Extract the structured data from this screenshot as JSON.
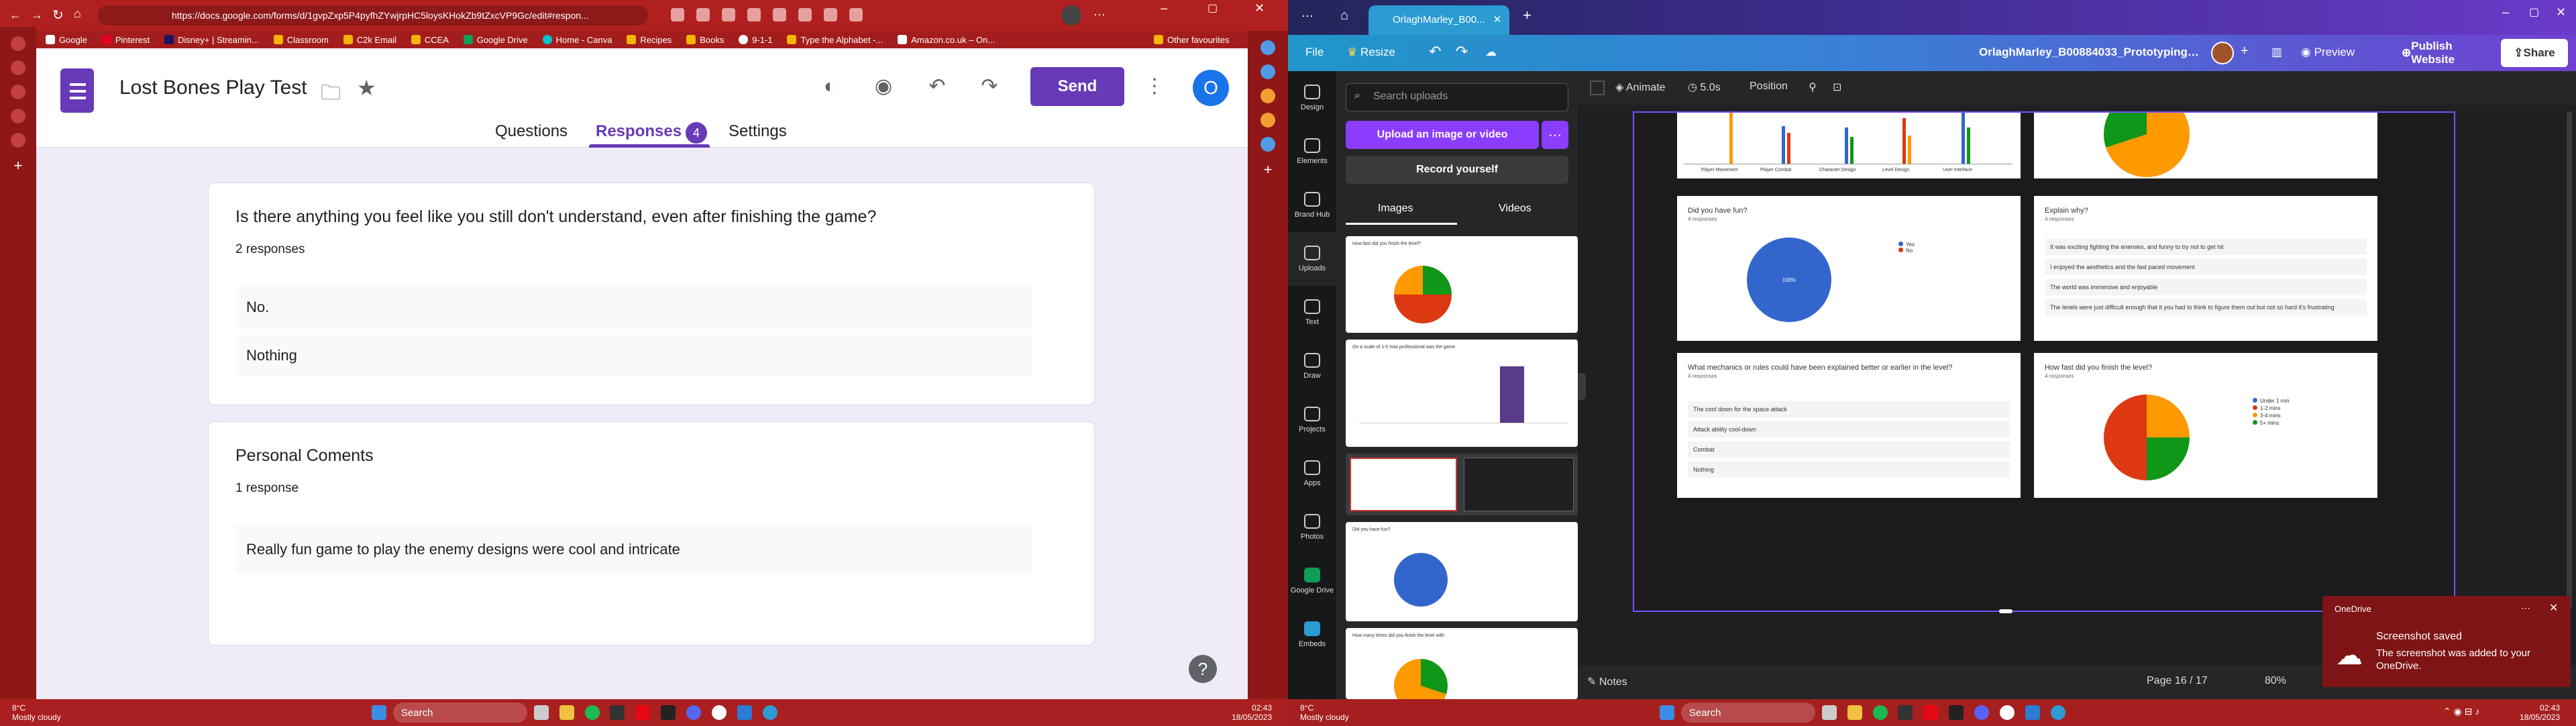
{
  "left_browser": {
    "url": "https://docs.google.com/forms/d/1gvpZxp5P4pyfhZYwjrpHC5loysKHokZb9tZxcVP9Gc/edit#respon...",
    "bookmarks": [
      "Google",
      "Pinterest",
      "Disney+ | Streamin...",
      "Classroom",
      "C2k Email",
      "CCEA",
      "Google Drive",
      "Home - Canva",
      "Recipes",
      "Books",
      "9-1-1",
      "Type the Alphabet -...",
      "Amazon.co.uk – On..."
    ],
    "other_bookmarks": "Other favourites"
  },
  "forms": {
    "title": "Lost Bones Play Test",
    "send": "Send",
    "avatar": "O",
    "tabs": {
      "questions": "Questions",
      "responses": "Responses",
      "responses_count": "4",
      "settings": "Settings"
    },
    "q1": {
      "title": "Is there anything you feel like you still don't understand, even after finishing the game?",
      "count": "2 responses",
      "answers": [
        "No.",
        "Nothing"
      ]
    },
    "q2": {
      "title": "Personal Coments",
      "count": "1 response",
      "answers": [
        "Really fun game to play the enemy designs were cool and intricate"
      ]
    },
    "help": "?"
  },
  "left_taskbar": {
    "temp": "8°C",
    "weather": "Mostly cloudy",
    "search": "Search",
    "time": "02:43",
    "date": "18/05/2023"
  },
  "canva": {
    "tab_title": "OrlaghMarley_B00...",
    "file": "File",
    "resize": "Resize",
    "doc_name": "OrlaghMarley_B00884033_Prototyping_Blog",
    "preview": "Preview",
    "publish": "Publish Website",
    "share": "Share",
    "rail": [
      "Design",
      "Elements",
      "Brand Hub",
      "Uploads",
      "Text",
      "Draw",
      "Projects",
      "Apps",
      "Photos",
      "Google Drive",
      "Embeds"
    ],
    "search_placeholder": "Search uploads",
    "upload_btn": "Upload an image or video",
    "record_btn": "Record yourself",
    "panel_tabs": [
      "Images",
      "Videos"
    ],
    "controls": {
      "animate": "Animate",
      "duration": "5.0s",
      "position": "Position"
    },
    "slide": {
      "bars_categories": [
        "Player Movement",
        "Player Combat",
        "Character Design",
        "Level Design",
        "User Interface"
      ],
      "fun_title": "Did you have fun?",
      "fun_count": "4 responses",
      "fun_pct": "100%",
      "fun_legend": [
        "Yes",
        "No"
      ],
      "explain_title": "Explain why?",
      "explain_count": "4 responses",
      "explain_rows": [
        "It was exciting fighting the enemies, and funny to try not to get hit",
        "I enjoyed the aesthetics and the fast paced movement",
        "The world was immersive and enjoyable",
        "The levels were just difficult enough that it you had to think to figure them out but not so hard it's frustrating"
      ],
      "mech_title": "What mechanics or rules could have been explained better or earlier in the level?",
      "mech_count": "4 responses",
      "mech_rows": [
        "The cool down for the space attack",
        "Attack ability cool-down",
        "Combat",
        "Nothing"
      ],
      "fast_title": "How fast did you finish the level?",
      "fast_count": "4 responses",
      "fast_legend": [
        "Under 1 min",
        "1-2 mins",
        "3-4 mins",
        "5+ mins"
      ],
      "fast_slices": [
        {
          "label": "1-2 mins",
          "value": 25,
          "color": "#ff9900"
        },
        {
          "label": "3-4 mins",
          "value": 25,
          "color": "#109618"
        },
        {
          "label": "Under 1 min",
          "value": 50,
          "color": "#dc3912"
        }
      ]
    },
    "notes": "Notes",
    "page": "Page 16 / 17",
    "zoom": "80%",
    "thumbs": [
      "How fast did you finish the level?",
      "On a scale of 1-5 how professional was the game",
      "Did you have fun?",
      "How many times did you finish the level with"
    ]
  },
  "onedrive": {
    "app": "OneDrive",
    "title": "Screenshot saved",
    "body": "The screenshot was added to your OneDrive."
  },
  "right_taskbar": {
    "temp": "8°C",
    "weather": "Mostly cloudy",
    "search": "Search",
    "time": "02:43",
    "date": "18/05/2023"
  }
}
